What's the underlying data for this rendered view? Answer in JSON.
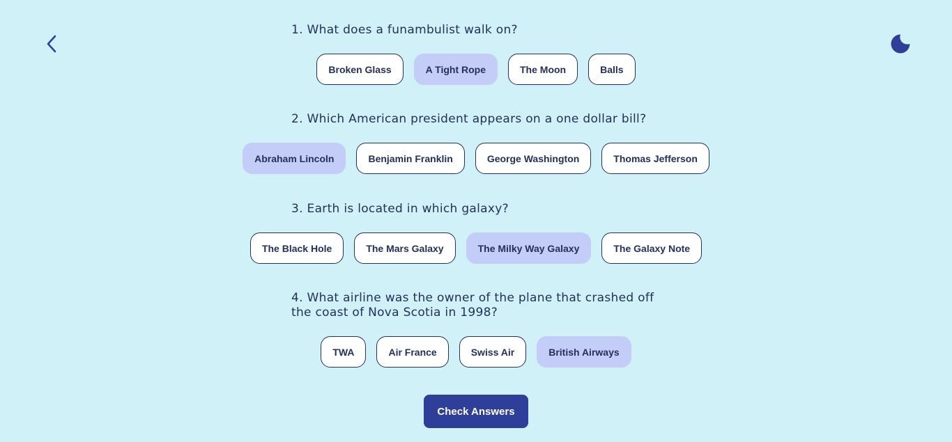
{
  "nav": {
    "back_icon": "chevron-left-icon",
    "theme_icon": "moon-icon"
  },
  "colors": {
    "background": "#d1f1f8",
    "text": "#243057",
    "selected": "#c3cdf8",
    "primary": "#2e3e99"
  },
  "questions": [
    {
      "text": "1. What does a funambulist walk on?",
      "answers": [
        {
          "label": "Broken Glass",
          "selected": false
        },
        {
          "label": "A Tight Rope",
          "selected": true
        },
        {
          "label": "The Moon",
          "selected": false
        },
        {
          "label": "Balls",
          "selected": false
        }
      ]
    },
    {
      "text": "2. Which American president appears on a one dollar bill?",
      "answers": [
        {
          "label": "Abraham Lincoln",
          "selected": true
        },
        {
          "label": "Benjamin Franklin",
          "selected": false
        },
        {
          "label": "George Washington",
          "selected": false
        },
        {
          "label": "Thomas Jefferson",
          "selected": false
        }
      ]
    },
    {
      "text": "3. Earth is located in which galaxy?",
      "answers": [
        {
          "label": "The Black Hole",
          "selected": false
        },
        {
          "label": "The Mars Galaxy",
          "selected": false
        },
        {
          "label": "The Milky Way Galaxy",
          "selected": true
        },
        {
          "label": "The Galaxy Note",
          "selected": false
        }
      ]
    },
    {
      "text": "4. What airline was the owner of the plane that crashed off the coast of Nova Scotia in 1998?",
      "answers": [
        {
          "label": "TWA",
          "selected": false
        },
        {
          "label": "Air France",
          "selected": false
        },
        {
          "label": "Swiss Air",
          "selected": false
        },
        {
          "label": "British Airways",
          "selected": true
        }
      ]
    }
  ],
  "check_button_label": "Check Answers"
}
